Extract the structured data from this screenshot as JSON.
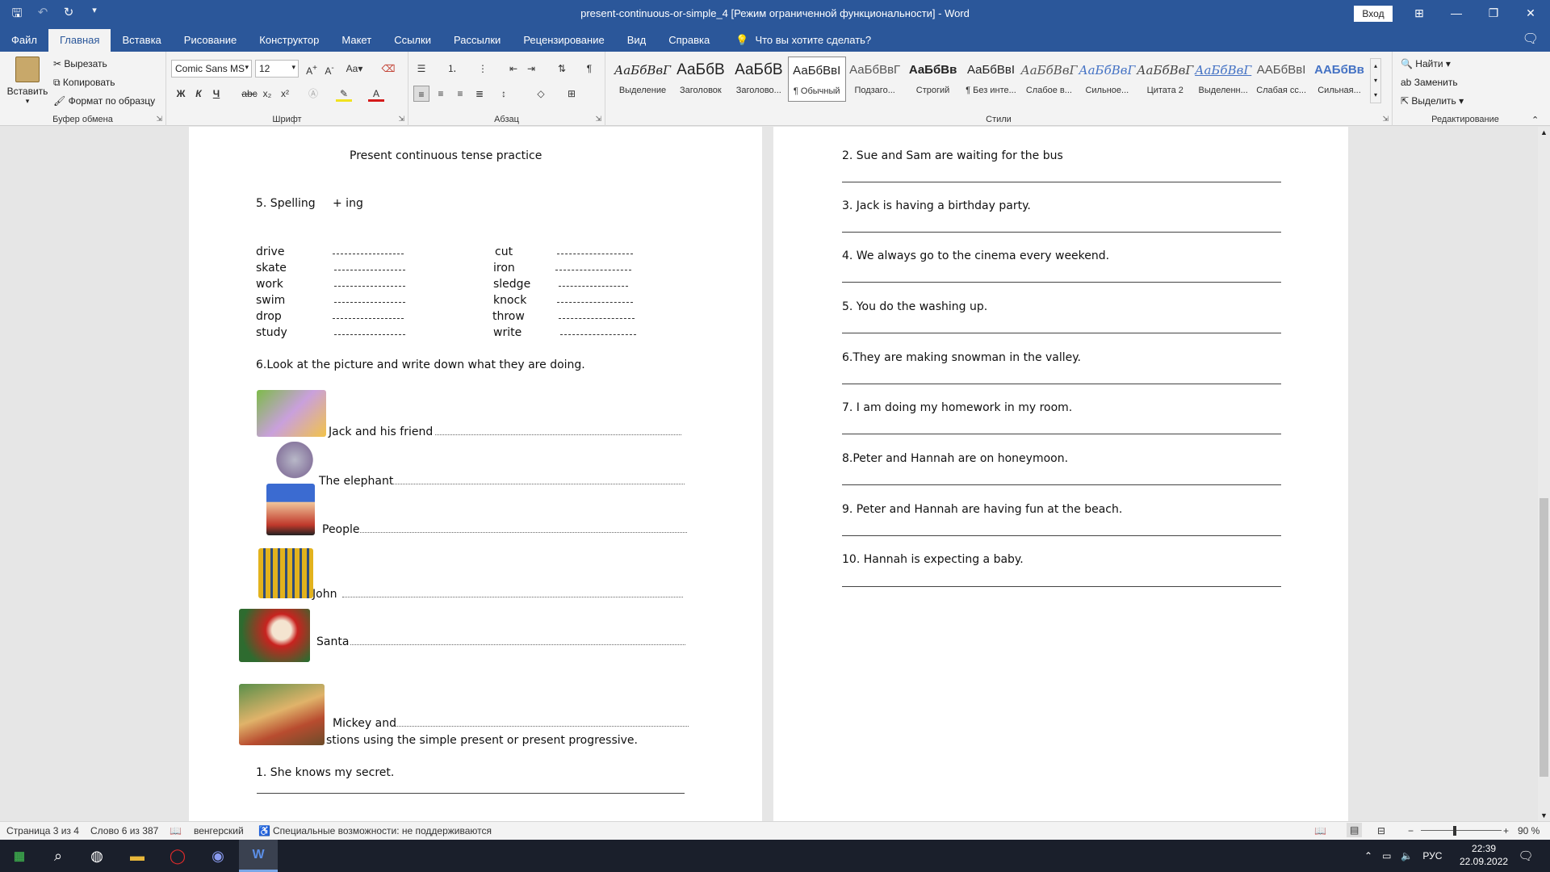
{
  "window": {
    "title": "present-continuous-or-simple_4 [Режим ограниченной функциональности]  -  Word",
    "signin": "Вход"
  },
  "tabs": [
    "Файл",
    "Главная",
    "Вставка",
    "Рисование",
    "Конструктор",
    "Макет",
    "Ссылки",
    "Рассылки",
    "Рецензирование",
    "Вид",
    "Справка"
  ],
  "tell_me": "Что вы хотите сделать?",
  "ribbon": {
    "clipboard": {
      "paste": "Вставить",
      "cut": "Вырезать",
      "copy": "Копировать",
      "format_painter": "Формат по образцу",
      "label": "Буфер обмена"
    },
    "font": {
      "name": "Comic Sans MS",
      "size": "12",
      "label": "Шрифт"
    },
    "paragraph": {
      "label": "Абзац"
    },
    "styles": {
      "label": "Стили",
      "items": [
        {
          "preview": "АаБбВвГ",
          "name": "Выделение"
        },
        {
          "preview": "АаБбВ",
          "name": "Заголовок"
        },
        {
          "preview": "АаБбВ",
          "name": "Заголово..."
        },
        {
          "preview": "АаБбВвІ",
          "name": "¶ Обычный"
        },
        {
          "preview": "АаБбВвГ",
          "name": "Подзаго..."
        },
        {
          "preview": "АаБбВв",
          "name": "Строгий"
        },
        {
          "preview": "АаБбВвІ",
          "name": "¶ Без инте..."
        },
        {
          "preview": "АаБбВвГ",
          "name": "Слабое в..."
        },
        {
          "preview": "АаБбВвГ",
          "name": "Сильное..."
        },
        {
          "preview": "АаБбВвГ",
          "name": "Цитата 2"
        },
        {
          "preview": "АаБбВвГ",
          "name": "Выделенн..."
        },
        {
          "preview": "ААБбВвІ",
          "name": "Слабая сс..."
        },
        {
          "preview": "ААБбВв",
          "name": "Сильная..."
        }
      ]
    },
    "editing": {
      "find": "Найти",
      "replace": "Заменить",
      "select": "Выделить",
      "label": "Редактирование"
    }
  },
  "page1": {
    "heading": "Present continuous tense practice",
    "spelling_title": "5. Spelling",
    "spelling_suffix": "+ ing",
    "words_left": [
      "drive",
      "skate",
      "work",
      "swim",
      "drop",
      "study"
    ],
    "words_right": [
      "cut",
      "iron",
      "sledge",
      "knock",
      "throw",
      "write"
    ],
    "task6": "6.Look at the picture and write down what they are doing.",
    "picture_items": [
      "Jack and his friend",
      "The elephant",
      "People",
      "John",
      "Santa",
      "Mickey and"
    ],
    "partial_line": "stions using the simple present  or present progressive.",
    "q1": "1. She knows my secret."
  },
  "page2": {
    "sentences": [
      "2. Sue and Sam are waiting for the bus",
      "3.  Jack is having a birthday party.",
      "4. We always go to the cinema every weekend.",
      "5. You do the washing up.",
      "6.They are making  snowman in the valley.",
      "7. I am doing my homework  in my room.",
      "8.Peter and Hannah are on honeymoon.",
      "9. Peter and  Hannah are having fun at the beach.",
      "10. Hannah is expecting a baby."
    ]
  },
  "status": {
    "page": "Страница 3 из 4",
    "words": "Слово 6 из 387",
    "language": "венгерский",
    "accessibility": "Специальные возможности: не поддерживаются",
    "zoom": "90 %"
  },
  "taskbar": {
    "lang": "РУС",
    "time": "22:39",
    "date": "22.09.2022"
  }
}
